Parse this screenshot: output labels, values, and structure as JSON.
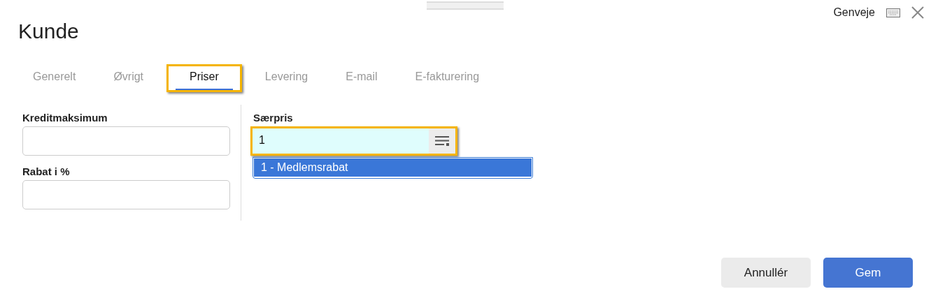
{
  "window": {
    "title": "Kunde",
    "shortcut_label": "Genveje"
  },
  "tabs": [
    {
      "label": "Generelt",
      "selected": false,
      "highlighted": false
    },
    {
      "label": "Øvrigt",
      "selected": false,
      "highlighted": false
    },
    {
      "label": "Priser",
      "selected": true,
      "highlighted": true
    },
    {
      "label": "Levering",
      "selected": false,
      "highlighted": false
    },
    {
      "label": "E-mail",
      "selected": false,
      "highlighted": false
    },
    {
      "label": "E-fakturering",
      "selected": false,
      "highlighted": false
    }
  ],
  "left_fields": [
    {
      "label": "Kreditmaksimum"
    },
    {
      "label": "Rabat i %"
    }
  ],
  "special_price": {
    "label": "Særpris",
    "value": "1",
    "highlighted": true,
    "suggestions": [
      {
        "text": "1 - Medlemsrabat",
        "selected": true
      }
    ]
  },
  "buttons": [
    {
      "label": "Annullér",
      "kind": "secondary"
    },
    {
      "label": "Gem",
      "kind": "primary"
    }
  ]
}
